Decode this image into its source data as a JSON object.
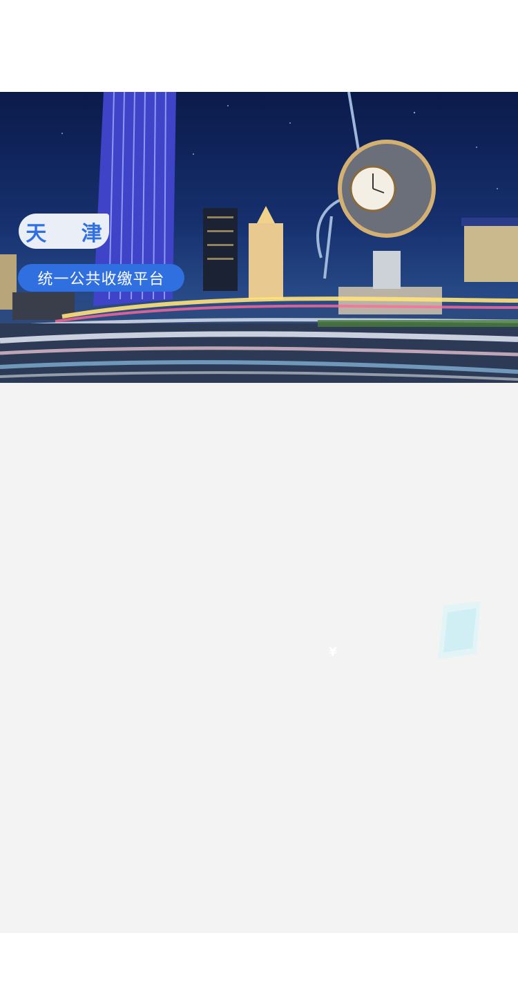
{
  "banner": {
    "city_label": "天 津",
    "platform_label": "统一公共收缴平台",
    "illustration": "tianjin-night-skyline-clock-photo"
  },
  "decor": {
    "yen_symbol": "¥",
    "glass_icon": "translucent-3d-shape-icon"
  },
  "colors": {
    "accent": "#2f6fe0",
    "city_pill_bg": "#e9eef7",
    "content_bg": "#f3f3f3",
    "page_bg": "#ffffff"
  }
}
